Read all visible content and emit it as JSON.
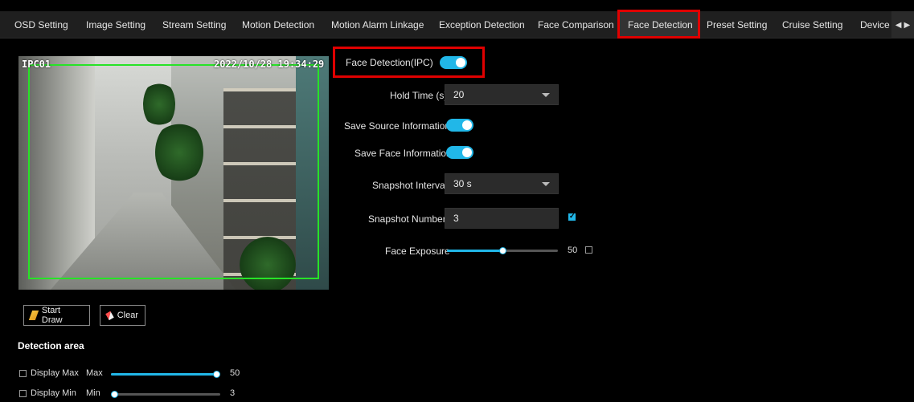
{
  "tabs": [
    {
      "label": "OSD Setting",
      "active": false
    },
    {
      "label": "Image Setting",
      "active": false
    },
    {
      "label": "Stream Setting",
      "active": false
    },
    {
      "label": "Motion Detection",
      "active": false
    },
    {
      "label": "Motion Alarm Linkage",
      "active": false
    },
    {
      "label": "Exception Detection",
      "active": false
    },
    {
      "label": "Face Comparison",
      "active": false
    },
    {
      "label": "Face Detection",
      "active": true
    },
    {
      "label": "Preset Setting",
      "active": false
    },
    {
      "label": "Cruise Setting",
      "active": false
    },
    {
      "label": "Device L",
      "active": false
    }
  ],
  "preview": {
    "camera_name": "IPC01",
    "timestamp": "2022/10/28 19:34:29"
  },
  "draw": {
    "start_draw_label": "Start Draw",
    "clear_label": "Clear"
  },
  "detection_area": {
    "title": "Detection area",
    "display_max_label": "Display Max",
    "max_label": "Max",
    "max_value": "50",
    "max_fraction": 1.0,
    "display_max_checked": false,
    "display_min_label": "Display Min",
    "min_label": "Min",
    "min_value": "3",
    "min_fraction": 0.0,
    "display_min_checked": false
  },
  "settings": {
    "face_detection_label": "Face Detection(IPC)",
    "face_detection_on": true,
    "hold_time_label": "Hold Time (s)",
    "hold_time_value": "20",
    "save_source_label": "Save Source Information",
    "save_source_on": true,
    "save_face_label": "Save Face Information",
    "save_face_on": true,
    "snapshot_interval_label": "Snapshot Interval",
    "snapshot_interval_value": "30 s",
    "snapshot_number_label": "Snapshot Number",
    "snapshot_number_value": "3",
    "snapshot_number_checked": true,
    "face_exposure_label": "Face Exposure",
    "face_exposure_value": "50",
    "face_exposure_fraction": 0.5,
    "face_exposure_checked": false
  },
  "colors": {
    "accent": "#21b7e8",
    "highlight": "#e00000",
    "detect_box": "#27e327"
  }
}
